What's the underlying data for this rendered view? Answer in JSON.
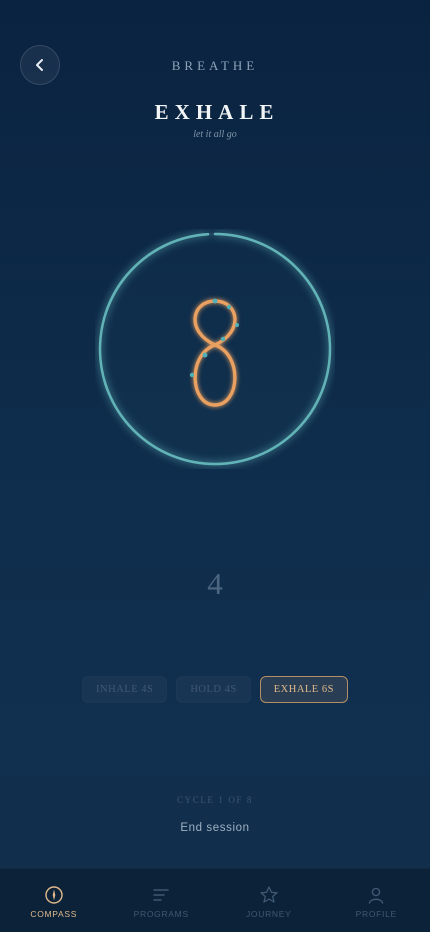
{
  "header": {
    "title": "BREATHE",
    "back_icon": "chevron-left-icon"
  },
  "phase": {
    "label": "EXHALE",
    "subtitle": "let it all go"
  },
  "breath_ring": {
    "progress": 0.99,
    "center_icon": "infinity-figure-eight-icon"
  },
  "countdown": "4",
  "phases": [
    {
      "label": "INHALE 4S",
      "active": false
    },
    {
      "label": "HOLD 4S",
      "active": false
    },
    {
      "label": "EXHALE 6S",
      "active": true
    }
  ],
  "cycle_text": "CYCLE 1 OF 8",
  "end_session_label": "End session",
  "tabs": [
    {
      "label": "COMPASS",
      "icon": "compass-icon",
      "active": true
    },
    {
      "label": "PROGRAMS",
      "icon": "list-icon",
      "active": false
    },
    {
      "label": "JOURNEY",
      "icon": "star-icon",
      "active": false
    },
    {
      "label": "PROFILE",
      "icon": "person-icon",
      "active": false
    }
  ],
  "colors": {
    "accent": "#e0b98c",
    "ring": "#62b3b7",
    "figure": "#e9a060",
    "background": "#0e2c4b"
  }
}
